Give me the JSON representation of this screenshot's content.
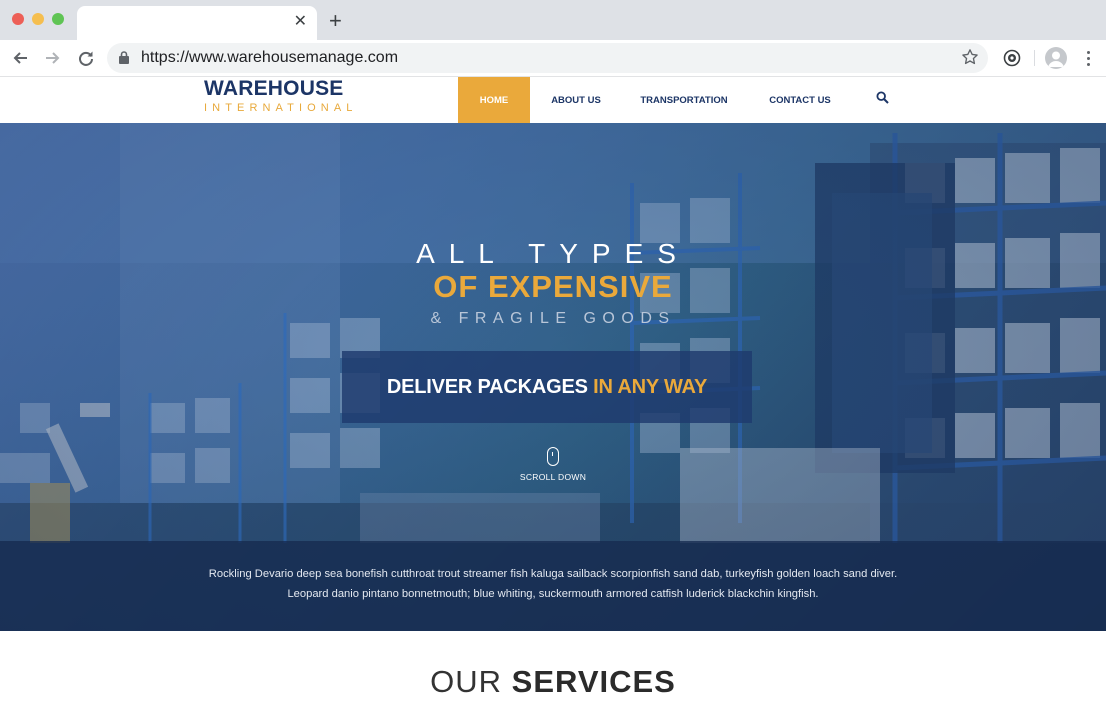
{
  "browser": {
    "tab_close_glyph": "✕",
    "new_tab_glyph": "+",
    "url": "https://www.warehousemanage.com"
  },
  "site": {
    "logo_main": "WAREHOUSE",
    "logo_sub": "INTERNATIONAL",
    "nav": [
      {
        "label": "HOME",
        "active": true
      },
      {
        "label": "ABOUT US",
        "active": false
      },
      {
        "label": "TRANSPORTATION",
        "active": false
      },
      {
        "label": "CONTACT US",
        "active": false
      }
    ],
    "colors": {
      "navy": "#1c3566",
      "accent": "#eaa93b"
    }
  },
  "hero": {
    "line1": "ALL TYPES",
    "line2": "OF EXPENSIVE",
    "line3": "& FRAGILE GOODS",
    "cta_white": "DELIVER PACKAGES",
    "cta_accent": "IN ANY WAY",
    "scroll_label": "SCROLL DOWN",
    "description": "Rockling Devario deep sea bonefish cutthroat trout streamer fish kaluga sailback scorpionfish sand dab, turkeyfish golden loach sand diver. Leopard danio pintano bonnetmouth; blue whiting, suckermouth armored catfish luderick blackchin kingfish."
  },
  "services": {
    "title_light": "OUR",
    "title_bold": "SERVICES"
  },
  "icons": [
    "close-icon",
    "plus-icon",
    "back-arrow-icon",
    "forward-arrow-icon",
    "reload-icon",
    "lock-icon",
    "star-icon",
    "extension-icon",
    "profile-icon",
    "menu-dots-icon",
    "search-icon",
    "mouse-icon"
  ]
}
